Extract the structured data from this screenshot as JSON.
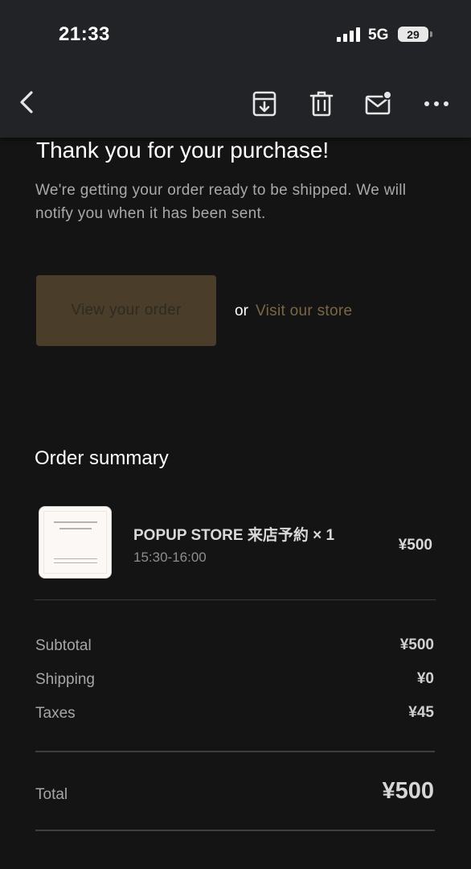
{
  "status_bar": {
    "time": "21:33",
    "network": "5G",
    "battery": "29"
  },
  "toolbar": {
    "icons": [
      "back-icon",
      "archive-icon",
      "trash-icon",
      "mail-icon",
      "more-icon"
    ]
  },
  "message": {
    "title": "Thank you for your purchase!",
    "body": "We're getting your order ready to be shipped. We will notify you when it has been sent.",
    "view_order_label": "View your order",
    "or_text": "or",
    "visit_store_label": "Visit our store"
  },
  "order_summary": {
    "heading": "Order summary",
    "items": [
      {
        "name": "POPUP STORE 来店予約 × 1",
        "detail": "15:30-16:00",
        "price": "¥500"
      }
    ],
    "rows": [
      {
        "label": "Subtotal",
        "value": "¥500"
      },
      {
        "label": "Shipping",
        "value": "¥0"
      },
      {
        "label": "Taxes",
        "value": "¥45"
      }
    ],
    "total_label": "Total",
    "total_value": "¥500"
  },
  "colors": {
    "background": "#141414",
    "toolbar": "#222326",
    "button": "#4a3e2b",
    "link": "#7a6745"
  }
}
